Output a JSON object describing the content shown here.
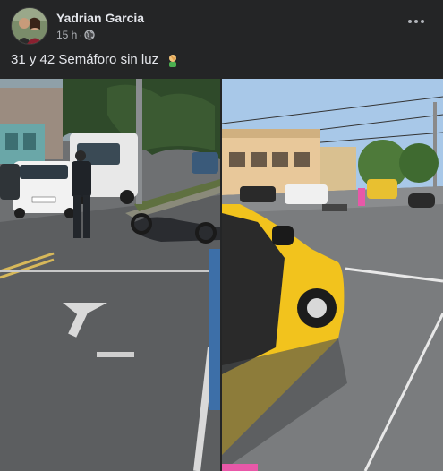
{
  "post": {
    "author": "Yadrian Garcia",
    "time": "15 h",
    "separator": "·",
    "privacy_icon": "globe-icon",
    "caption": "31 y 42 Semáforo sin luz",
    "caption_emoji_icon": "man-facepalming-icon",
    "more_icon": "more-horizontal-icon"
  },
  "photos": [
    {
      "description_icon": "photo-left"
    },
    {
      "description_icon": "photo-right"
    }
  ],
  "colors": {
    "background": "#242526",
    "text_primary": "#e4e6eb",
    "text_secondary": "#b0b3b8"
  }
}
